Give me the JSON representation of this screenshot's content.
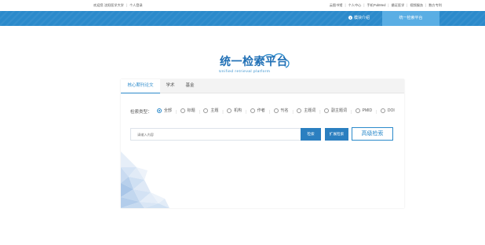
{
  "topbar": {
    "welcome": "欢迎您 沈阳医学大学",
    "personal_login": "个人登录",
    "links": [
      "云图书馆",
      "个人中心",
      "手机PubMed",
      "循证医学",
      "视频服务",
      "数方专利"
    ]
  },
  "navbar": {
    "intro": "模块介绍",
    "active": "统一检索平台"
  },
  "logo": {
    "title": "统一检索平台",
    "subtitle": "Unified retrieval platform"
  },
  "tabs": [
    "核心期刊论文",
    "学术",
    "基金"
  ],
  "search": {
    "type_label": "检索类型：",
    "options": [
      "全部",
      "标题",
      "主题",
      "机构",
      "作者",
      "刊名",
      "主题词",
      "副主题词",
      "PMID",
      "DOI"
    ],
    "selected": "全部",
    "placeholder": "请输入内容",
    "search_button": "检索",
    "expand_button": "扩展检索",
    "advanced_button": "高级检索"
  },
  "colors": {
    "primary": "#2b8acb",
    "nav_active": "#5aaee4",
    "button": "#2b7fc0"
  }
}
